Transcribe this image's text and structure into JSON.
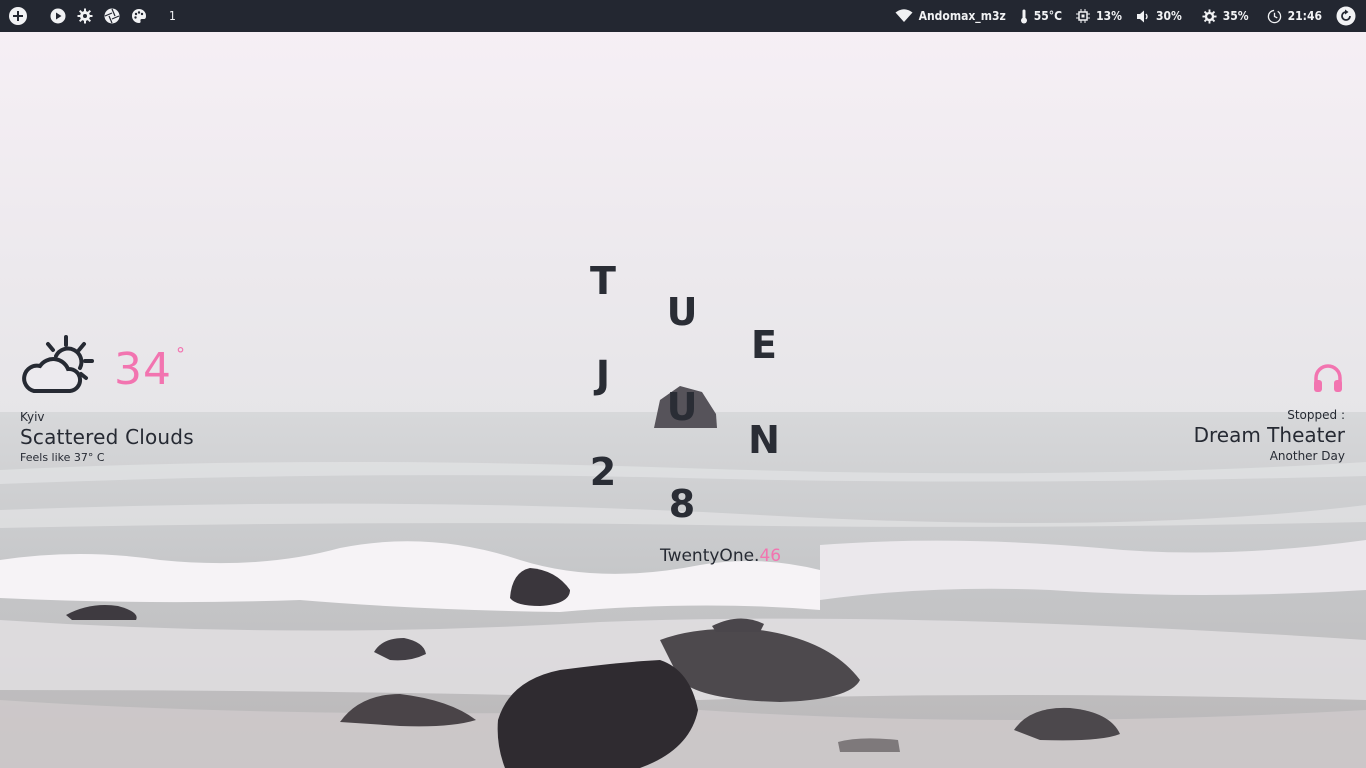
{
  "topbar": {
    "left_icons": [
      "add-circle-icon",
      "play-icon",
      "gear-icon",
      "aperture-icon",
      "palette-icon"
    ],
    "workspace": "1",
    "wifi_name": "Andomax_m3z",
    "temperature": "55°C",
    "cpu": "13%",
    "volume": "30%",
    "brightness": "35%",
    "clock": "21:46",
    "colors": {
      "bar_bg": "#232731",
      "text": "#f1f2f4"
    }
  },
  "weather": {
    "icon": "cloud-sun-icon",
    "temp": "34",
    "degree_symbol": "°",
    "city": "Kyiv",
    "description": "Scattered Clouds",
    "feels_like": "Feels like 37° C",
    "accent_color": "#f274b0"
  },
  "date": {
    "day_letters": [
      "T",
      "U",
      "E"
    ],
    "month_letters": [
      "J",
      "U",
      "N"
    ],
    "day_digits": [
      "2",
      "8"
    ],
    "time_words": "TwentyOne.",
    "time_minutes": "46"
  },
  "music": {
    "icon": "headphones-icon",
    "status": "Stopped :",
    "artist": "Dream Theater",
    "title": "Another Day"
  }
}
